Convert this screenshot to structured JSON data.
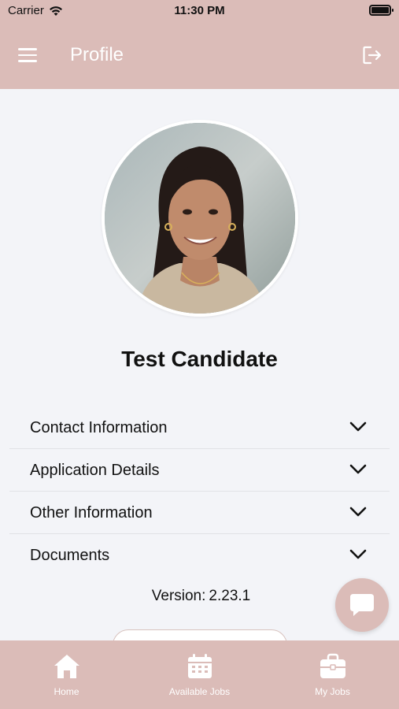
{
  "status_bar": {
    "carrier": "Carrier",
    "time": "11:30 PM"
  },
  "header": {
    "title": "Profile"
  },
  "profile": {
    "name": "Test Candidate"
  },
  "sections": [
    {
      "label": "Contact Information"
    },
    {
      "label": "Application Details"
    },
    {
      "label": "Other Information"
    },
    {
      "label": "Documents"
    }
  ],
  "version": {
    "label": "Version:",
    "value": "2.23.1"
  },
  "tabs": [
    {
      "label": "Home",
      "icon": "home-icon"
    },
    {
      "label": "Available Jobs",
      "icon": "calendar-icon"
    },
    {
      "label": "My Jobs",
      "icon": "briefcase-icon"
    }
  ],
  "colors": {
    "accent": "#dbbcb8",
    "background": "#f3f4f8",
    "text": "#111111"
  }
}
